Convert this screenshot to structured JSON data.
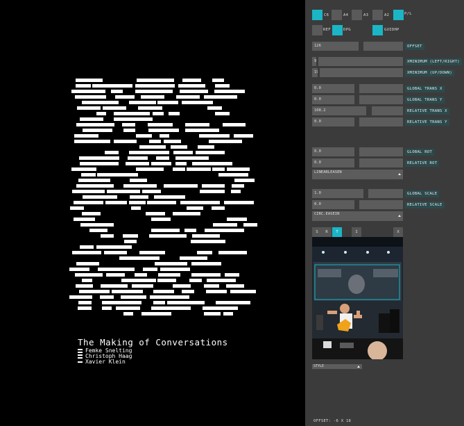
{
  "artwork": {
    "title": "The Making of Conversations",
    "credits": [
      {
        "icon": "equals-icon",
        "name": "Femke Snelting"
      },
      {
        "icon": "equals-icon",
        "name": "Christoph Haag"
      },
      {
        "icon": "dash-icon",
        "name": "Xavier Klein"
      }
    ]
  },
  "panel": {
    "formats": [
      {
        "label": "C6",
        "active": true
      },
      {
        "label": "A4",
        "active": false
      },
      {
        "label": "A3",
        "active": false
      },
      {
        "label": "A2",
        "active": false
      },
      {
        "label": "P/L",
        "active": true
      }
    ],
    "options": [
      {
        "label": "REF",
        "active": false
      },
      {
        "label": "DPG",
        "active": true
      },
      {
        "label": "GUIDHP",
        "active": true
      }
    ],
    "offset": {
      "value": "126",
      "label": "OFFSET"
    },
    "x_minimum": {
      "value": "9",
      "label": "XMINIMUM (LEFT/RIGHT)"
    },
    "y_minimum": {
      "value": "19",
      "label": "XMINIMUM (UP/DOWN)"
    },
    "global_trans_x": {
      "value": "0.0",
      "label": "GLOBAL TRANS X"
    },
    "global_trans_y": {
      "value": "0.0",
      "label": "GLOBAL TRANS Y"
    },
    "relative_trans_x": {
      "value": "108.2",
      "label": "RELATIVE TRANS X"
    },
    "relative_trans_y": {
      "value": "0.0",
      "label": "RELATIVE TRANS Y"
    },
    "global_rot": {
      "value": "0.0",
      "label": "GLOBAL ROT"
    },
    "relative_rot": {
      "value": "0.0",
      "label": "RELATIVE ROT"
    },
    "rot_easing": "LINEARLEASEN",
    "global_scale": {
      "value": "1.0",
      "label": "GLOBAL SCALE"
    },
    "relative_scale": {
      "value": "0.0",
      "label": "RELATIVE SCALE"
    },
    "scale_easing": "CIRC.EASEIN",
    "tabs": [
      {
        "label": "S",
        "active": false
      },
      {
        "label": "R",
        "active": false
      },
      {
        "label": "T",
        "active": true
      },
      {
        "label": "I",
        "active": false
      },
      {
        "label": "X",
        "active": false
      }
    ],
    "style_select": "STYLE",
    "offset_readout": "OFFSET: -6 X 18"
  },
  "colors": {
    "accent": "#1ab6c6",
    "panel_bg": "#3b3b3b",
    "field_bg": "#5c5c5c",
    "tag_bg": "#2c4a4c"
  }
}
